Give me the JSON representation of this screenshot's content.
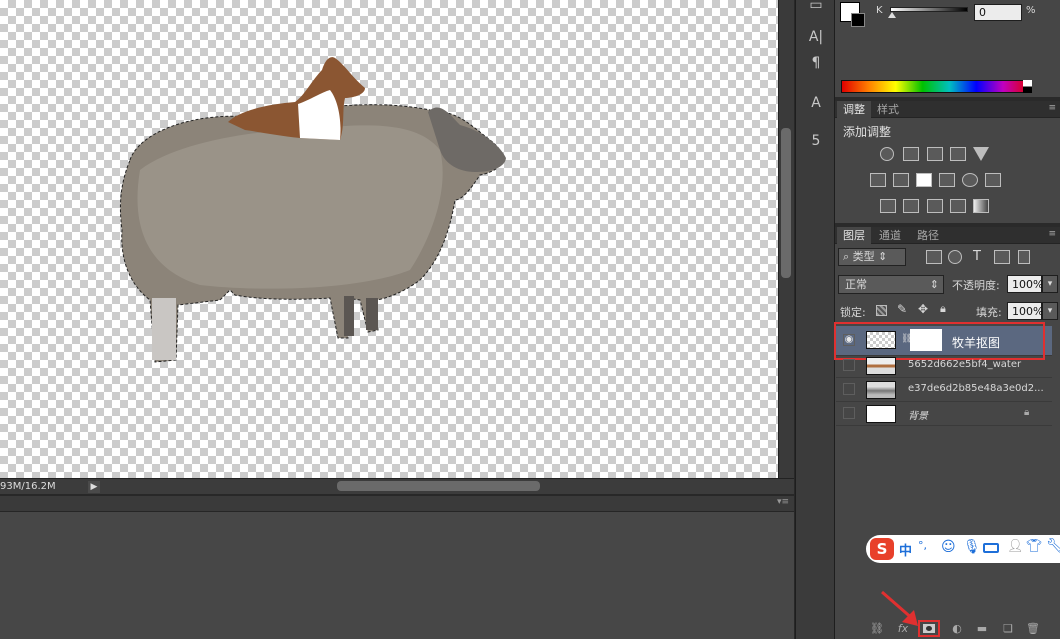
{
  "canvas": {
    "description_hidden": ""
  },
  "status": {
    "doc_size": "93M/16.2M",
    "arrow": "▶"
  },
  "tools": {
    "items": [
      "A|",
      "¶",
      "A",
      "5"
    ]
  },
  "color_panel": {
    "channel_label": "K",
    "value": "0",
    "unit": "%"
  },
  "adjust_panel": {
    "tabs": [
      "调整",
      "样式"
    ],
    "title": "添加调整"
  },
  "layers_panel": {
    "tabs": [
      "图层",
      "通道",
      "路径"
    ],
    "filter_label": "类型",
    "blend_mode": "正常",
    "opacity_label": "不透明度:",
    "opacity_value": "100%",
    "lock_label": "锁定:",
    "fill_label": "填充:",
    "fill_value": "100%",
    "layers": [
      {
        "name": "牧羊抠图",
        "visible": true,
        "selected": true
      },
      {
        "name": "5652d662e5bf4_water",
        "visible": false,
        "selected": false
      },
      {
        "name": "e37de6d2b85e48a3e0d2...",
        "visible": false,
        "selected": false
      },
      {
        "name": "背景",
        "visible": false,
        "selected": false
      }
    ]
  },
  "ime": {
    "logo": "S",
    "lang": "中",
    "punct": "°,"
  },
  "colors": {
    "highlight": "#e03030",
    "panel_bg": "#464646",
    "ime_blue": "#1e6fd9"
  }
}
